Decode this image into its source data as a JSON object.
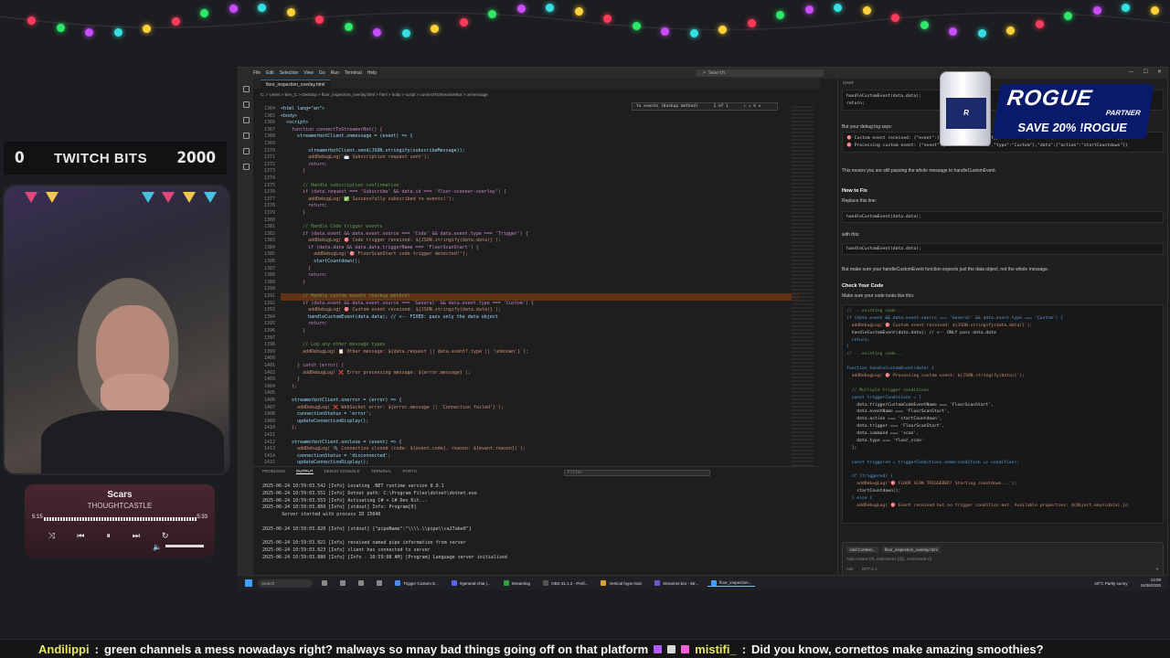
{
  "bits_bar": {
    "left_value": "0",
    "label": "TWITCH BITS",
    "right_value": "2000"
  },
  "player": {
    "title": "Scars",
    "artist": "THOUGHTCASTLE",
    "elapsed": "5:15",
    "total": "5:33"
  },
  "vscode": {
    "menu": [
      "File",
      "Edit",
      "Selection",
      "View",
      "Go",
      "Run",
      "Terminal",
      "Help"
    ],
    "search_placeholder": "Search",
    "tab": "floor_inspection_overlay.html",
    "breadcrumb": "C: > Users > Ben_C > Desktop > floor_inspection_overlay.html > html > body > script > connectToStreamerBot > onmessage",
    "find": {
      "value": "to events (backup method)",
      "count": "1 of 1"
    },
    "gutter": [
      "1364",
      "1365",
      "1366",
      "1367",
      "1368",
      "1369",
      "1370",
      "1371",
      "1372",
      "1373",
      "1374",
      "1375",
      "1376",
      "1377",
      "1378",
      "1379",
      "1380",
      "1381",
      "1382",
      "1383",
      "1384",
      "1385",
      "1386",
      "1387",
      "1388",
      "1389",
      "1390",
      "1391",
      "1392",
      "1393",
      "1394",
      "1395",
      "1396",
      "1397",
      "1398",
      "1399",
      "1400",
      "1401",
      "1402",
      "1403",
      "1404",
      "1405",
      "1406",
      "1407",
      "1408",
      "1409",
      "1410",
      "1411",
      "1412",
      "1413",
      "1414",
      "1415"
    ],
    "code": [
      "<html lang=\"en\">",
      "<body>",
      "  <script>",
      "    function connectToStreamerBot() {",
      "      streamerbotClient.onmessage = (event) => {",
      "",
      "          streamerbotClient.send(JSON.stringify(subscribeMessage));",
      "          addDebugLog('📩 Subscription request sent');",
      "          return;",
      "        }",
      "",
      "        // Handle subscription confirmation",
      "        if (data.request === 'Subscribe' && data.id === 'floor-scanner-overlay') {",
      "          addDebugLog('✅ Successfully subscribed to events!');",
      "          return;",
      "        }",
      "",
      "        // Handle Code trigger events",
      "        if (data.event && data.event.source === 'Code' && data.event.type === 'Trigger') {",
      "          addDebugLog(`🎯 Code trigger received: ${JSON.stringify(data.data)}`);",
      "          if (data.data && data.data.triggerName === 'FloorScanStart') {",
      "            addDebugLog('🎯 FloorScanStart code trigger detected!');",
      "            startCountdown();",
      "          }",
      "          return;",
      "        }",
      "",
      "        // Handle custom events (backup method)",
      "        if (data.event && data.event.source === 'General' && data.event.type === 'Custom') {",
      "          addDebugLog(`🎯 Custom event received: ${JSON.stringify(data.data)}`);",
      "          handleCustomEvent(data.data); // <-- FIXED: pass only the data object",
      "          return;",
      "        }",
      "",
      "        // Log any other message types",
      "        addDebugLog(`📋 Other message: ${data.request || data.event?.type || 'unknown'}`);",
      "",
      "      } catch (error) {",
      "        addDebugLog(`❌ Error processing message: ${error.message}`);",
      "      }",
      "    };",
      "",
      "    streamerbotClient.onerror = (error) => {",
      "      addDebugLog(`❌ WebSocket error: ${error.message || 'Connection failed'}`);",
      "      connectionStatus = 'error';",
      "      updateConnectionDisplay();",
      "    };",
      "",
      "    streamerbotClient.onclose = (event) => {",
      "      addDebugLog(`🔌 Connection closed (code: ${event.code}, reason: ${event.reason})`);",
      "      connectionStatus = 'disconnected';",
      "      updateConnectionDisplay();"
    ],
    "panel_tabs": [
      "PROBLEMS",
      "OUTPUT",
      "DEBUG CONSOLE",
      "TERMINAL",
      "PORTS"
    ],
    "panel_active": "OUTPUT",
    "panel_filter": "Filter",
    "panel_log": [
      "2025-06-24 10:59:03.542 [Info] Locating .NET runtime version 8.0.1",
      "2025-06-24 10:59:03.551 [Info] Dotnet path: C:\\Program Files\\dotnet\\dotnet.exe",
      "2025-06-24 10:59:03.553 [Info] Activating C# + C# Dev Kit...",
      "2025-06-24 10:59:03.869 [Info] [stdout] Info: Program[0]",
      "       Server started with process ID 15640",
      "",
      "2025-06-24 10:59:03.820 [Info] [stdout] {\"pipeName\":\"\\\\\\\\.\\\\pipe\\\\ca27abe0\"}",
      "",
      "2025-06-24 10:59:03.821 [Info] received named pipe information from server",
      "2025-06-24 10:59:03.823 [Info] client has connected to server",
      "2025-06-24 10:59:03.880 [Info] [Info - 10:59:08 AM] [Program] Language server initialized"
    ],
    "status_right": "Ln 1394, Col 28   Spaces: 4   UTF-8   CRLF   {} HTML",
    "chat": {
      "header": "CHAT",
      "top_code": [
        "handleCustomEvent(data.data);",
        "return;"
      ],
      "debug_intro": "But your debug log says:",
      "debug_lines": [
        "🎯 Custom event received: {\"event\":{\"source\":\"General\",\"type\":\"Custom\"},\"data\":{\"action\":\"startCountdown\"}}",
        "🎯 Processing custom event: {\"event\":{\"source\":\"General\",\"type\":\"Custom\"},\"data\":{\"action\":\"startCountdown\"}}"
      ],
      "means": "This means you are still passing the whole message to handleCustomEvent.",
      "how_to_fix": "How to Fix",
      "replace": "Replace this line:",
      "replace_code": "handleCustomEvent(data.data);",
      "with_this": "with this:",
      "with_code": "handleCustomEvent(data.data);",
      "make_sure": "But make sure your handleCustomEvent function expects just the data object, not the whole message.",
      "check": "Check Your Code",
      "check_sub": "Make sure your code looks like this:",
      "final_code": [
        "// ...existing code...",
        "if (data.event && data.event.source === 'General' && data.event.type === 'Custom') {",
        "  addDebugLog(`🎯 Custom event received: ${JSON.stringify(data.data)}`);",
        "  handleCustomEvent(data.data); // <-- ONLY pass data.data",
        "  return;",
        "}",
        "// ...existing code...",
        "",
        "function handleCustomEvent(data) {",
        "  addDebugLog(`🎯 Processing custom event: ${JSON.stringify(data)}`);",
        "",
        "  // Multiple trigger conditions",
        "  const triggerConditions = [",
        "    data.triggerCustomCodeEventName === 'FloorScanStart',",
        "    data.eventName === 'FloorScanStart',",
        "    data.action === 'startCountdown',",
        "    data.trigger === 'FloorScanStart',",
        "    data.command === 'scan',",
        "    data.type === 'floor_scan'",
        "  ];",
        "",
        "  const triggered = triggerConditions.some(condition => condition);",
        "",
        "  if (triggered) {",
        "    addDebugLog('🎯 FLOOR SCAN TRIGGERED! Starting countdown...');",
        "    startCountdown();",
        "  } else {",
        "    addDebugLog(`🎯 Event received but no trigger condition met. Available properties: ${Object.keys(data).jo"
      ],
      "input_chips": [
        "Add Context...",
        "floor_inspection_overlay.html"
      ],
      "input_placeholder": "Add context (#), extensions (@), commands (/)",
      "input_mode": "Ask",
      "input_model": "GPT-4.1"
    }
  },
  "taskbar": {
    "search": "Search",
    "apps": [
      "Trigger Custom E...",
      "#general-chat |...",
      "Streamlog",
      "OBS 31.1.2 - Profi...",
      "Vertical hype train",
      "Streamer.bot - Str...",
      "floor_inspection..."
    ],
    "weather": "20°C Partly sunny",
    "time": "13:09",
    "date": "24/06/2025"
  },
  "sponsor": {
    "brand": "ROGUE",
    "partner": "PARTNER",
    "promo": "SAVE 20% !ROGUE"
  },
  "ticker": [
    {
      "user": "Andilippi",
      "message": "green channels a mess nowadays right? malways so mnay bad things going off on that platform"
    },
    {
      "user": "mistifi_",
      "message": "Did you know, cornettos make amazing smoothies?"
    }
  ]
}
